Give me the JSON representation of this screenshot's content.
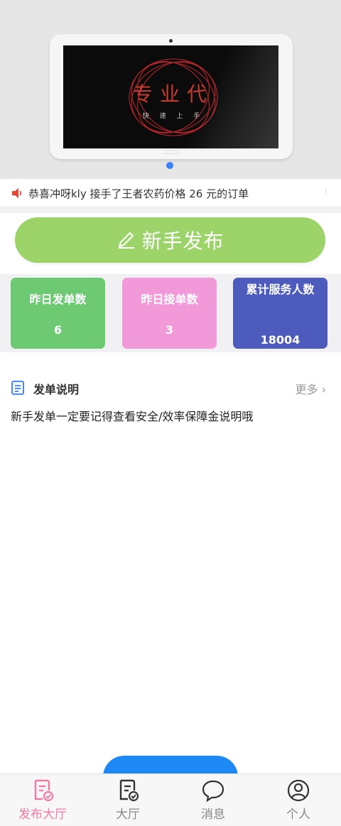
{
  "banner": {
    "logo_text": "专业代",
    "logo_subtext": "快 速 上 手",
    "slide_count": 1,
    "active_slide": 1
  },
  "notice": {
    "icon": "speaker-icon",
    "text": "恭喜冲呀kly 接手了王者农药价格 26 元的订单"
  },
  "publish": {
    "icon": "pencil-icon",
    "label": "新手发布"
  },
  "stats": [
    {
      "title": "昨日发单数",
      "value": "6",
      "color": "#6dca73"
    },
    {
      "title": "昨日接单数",
      "value": "3",
      "color": "#f29ad9"
    },
    {
      "title": "累计服务人数",
      "value": "18004",
      "color": "#4d5bbd"
    }
  ],
  "notes": {
    "icon": "document-icon",
    "title": "发单说明",
    "more_label": "更多",
    "content": "新手发单一定要记得查看安全/效率保障金说明哦"
  },
  "tabbar": {
    "items": [
      {
        "label": "发布大厅",
        "icon": "publish-doc-icon",
        "active": true
      },
      {
        "label": "大厅",
        "icon": "hall-doc-icon",
        "active": false
      },
      {
        "label": "消息",
        "icon": "chat-bubble-icon",
        "active": false
      },
      {
        "label": "个人",
        "icon": "user-icon",
        "active": false
      }
    ],
    "active_color": "#f07aa6",
    "inactive_color": "#888888"
  }
}
